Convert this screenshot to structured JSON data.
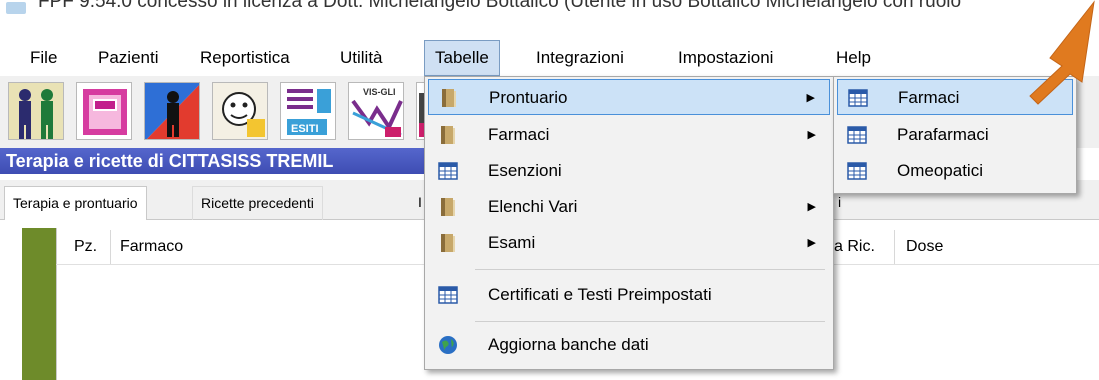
{
  "title_bar": {
    "text": "FPF 9.54.0 concesso in licenza a Dott. Michelangelo Bottalico (Utente in uso Bottalico Michelangelo con ruolo"
  },
  "menu_bar": {
    "items": [
      "File",
      "Pazienti",
      "Reportistica",
      "Utilità",
      "Tabelle",
      "Integrazioni",
      "Impostazioni",
      "Help"
    ],
    "active": "Tabelle"
  },
  "toolbar": {
    "buttons": [
      {
        "icon": "people-icon"
      },
      {
        "icon": "pink-grid-icon"
      },
      {
        "icon": "person-red-icon"
      },
      {
        "icon": "face-icon"
      },
      {
        "icon": "esiti-icon",
        "label": "ESITI"
      },
      {
        "icon": "vis-icon",
        "label": "VIS-GLI"
      },
      {
        "icon": "extra-icon"
      }
    ]
  },
  "patient_header": {
    "text": "Terapia e ricette di CITTASISS TREMIL"
  },
  "tabs": {
    "items": [
      "Terapia e prontuario",
      "Ricette precedenti"
    ],
    "active": "Terapia e prontuario",
    "fragments": [
      "I",
      "i"
    ]
  },
  "table_header": {
    "columns": [
      "Pz.",
      "Farmaco",
      "a Ric.",
      "Dose"
    ]
  },
  "dropdown": {
    "items": [
      {
        "label": "Prontuario",
        "icon": "book-icon",
        "has_submenu": true,
        "highlighted": true
      },
      {
        "label": "Farmaci",
        "icon": "book-icon",
        "has_submenu": true
      },
      {
        "label": "Esenzioni",
        "icon": "table-icon",
        "has_submenu": false
      },
      {
        "label": "Elenchi Vari",
        "icon": "book-icon",
        "has_submenu": true
      },
      {
        "label": "Esami",
        "icon": "book-icon",
        "has_submenu": true
      },
      {
        "label": "Certificati e Testi Preimpostati",
        "icon": "table-icon",
        "has_submenu": false
      },
      {
        "label": "Aggiorna banche dati",
        "icon": "globe-icon",
        "has_submenu": false
      }
    ],
    "arrow_glyph": "▶"
  },
  "submenu": {
    "items": [
      {
        "label": "Farmaci",
        "icon": "table-icon",
        "highlighted": true
      },
      {
        "label": "Parafarmaci",
        "icon": "table-icon"
      },
      {
        "label": "Omeopatici",
        "icon": "table-icon"
      }
    ]
  },
  "colors": {
    "menu_highlight": "#cce2f7",
    "header_blue": "#3e4db3",
    "green_bar": "#6e8b2a",
    "arrow_orange": "#e07a1f"
  }
}
